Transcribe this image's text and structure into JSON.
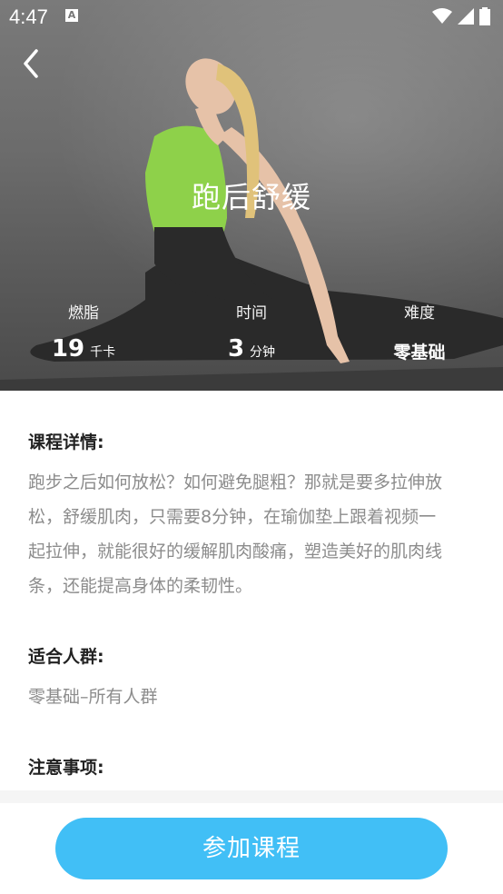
{
  "status_bar": {
    "time": "4:47",
    "notification_icon": "a-icon"
  },
  "header": {
    "title": "跑后舒缓"
  },
  "stats": [
    {
      "label": "燃脂",
      "value": "19",
      "unit": "千卡"
    },
    {
      "label": "时间",
      "value": "3",
      "unit": "分钟"
    },
    {
      "label": "难度",
      "value": "零基础",
      "unit": ""
    }
  ],
  "sections": [
    {
      "heading": "课程详情:",
      "lines": [
        "跑步之后如何放松？如何避免腿粗？那就是要多拉伸放",
        "松，舒缓肌肉，只需要8分钟，在瑜伽垫上跟着视频一",
        "起拉伸，就能很好的缓解肌肉酸痛，塑造美好的肌肉线",
        "条，还能提高身体的柔韧性。"
      ]
    },
    {
      "heading": "适合人群:",
      "lines": [
        "零基础–所有人群"
      ]
    },
    {
      "heading": "注意事项:",
      "lines": []
    }
  ],
  "cta": {
    "label": "参加课程"
  },
  "colors": {
    "accent": "#41bff6",
    "heading": "#222222",
    "body_text": "#8c8c8c"
  },
  "icons": [
    "back-arrow-icon",
    "wifi-icon",
    "signal-icon",
    "battery-icon"
  ]
}
